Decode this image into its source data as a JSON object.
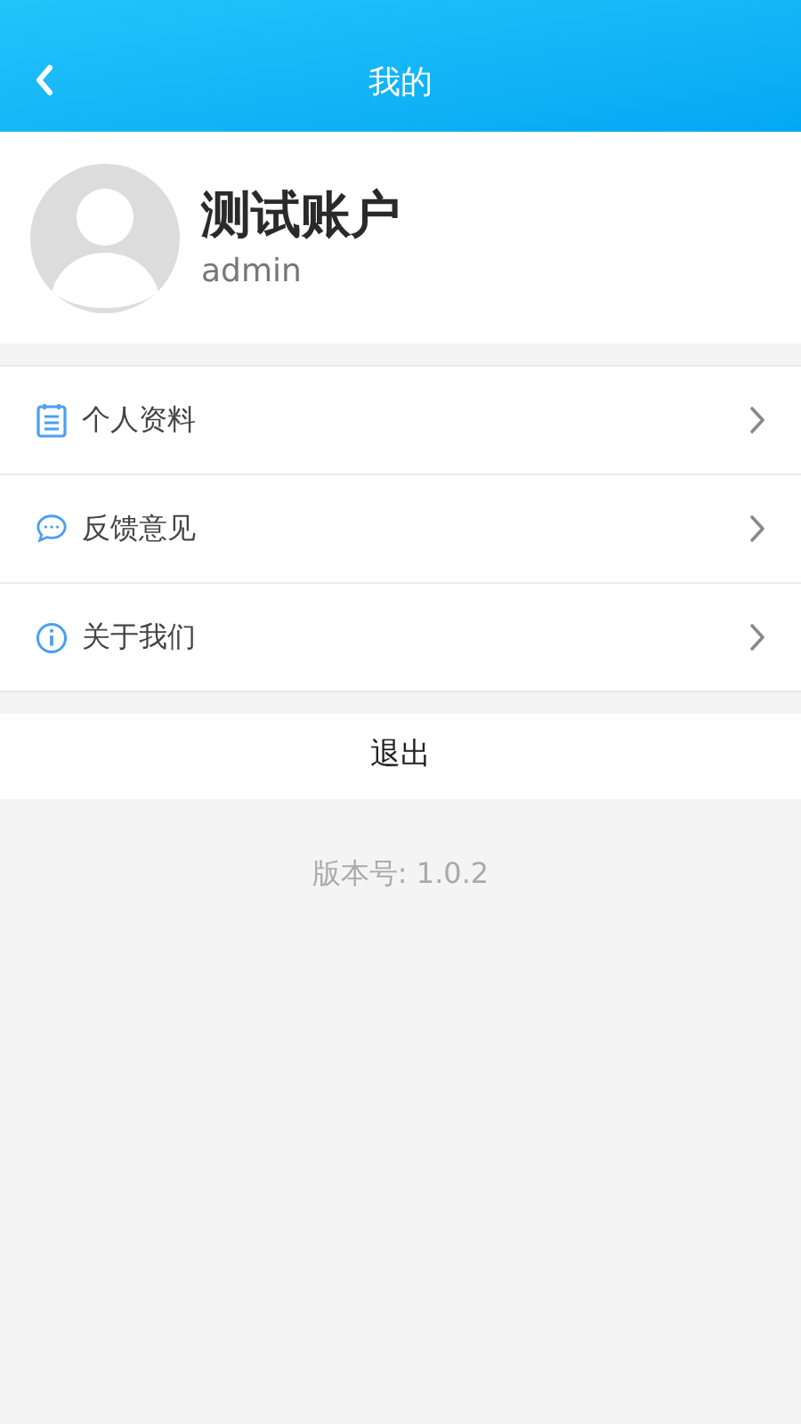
{
  "header": {
    "title": "我的"
  },
  "profile": {
    "name": "测试账户",
    "username": "admin"
  },
  "menu": [
    {
      "kind": "document",
      "label": "个人资料"
    },
    {
      "kind": "chat",
      "label": "反馈意见"
    },
    {
      "kind": "info",
      "label": "关于我们"
    }
  ],
  "logout": "退出",
  "version": "版本号: 1.0.2"
}
